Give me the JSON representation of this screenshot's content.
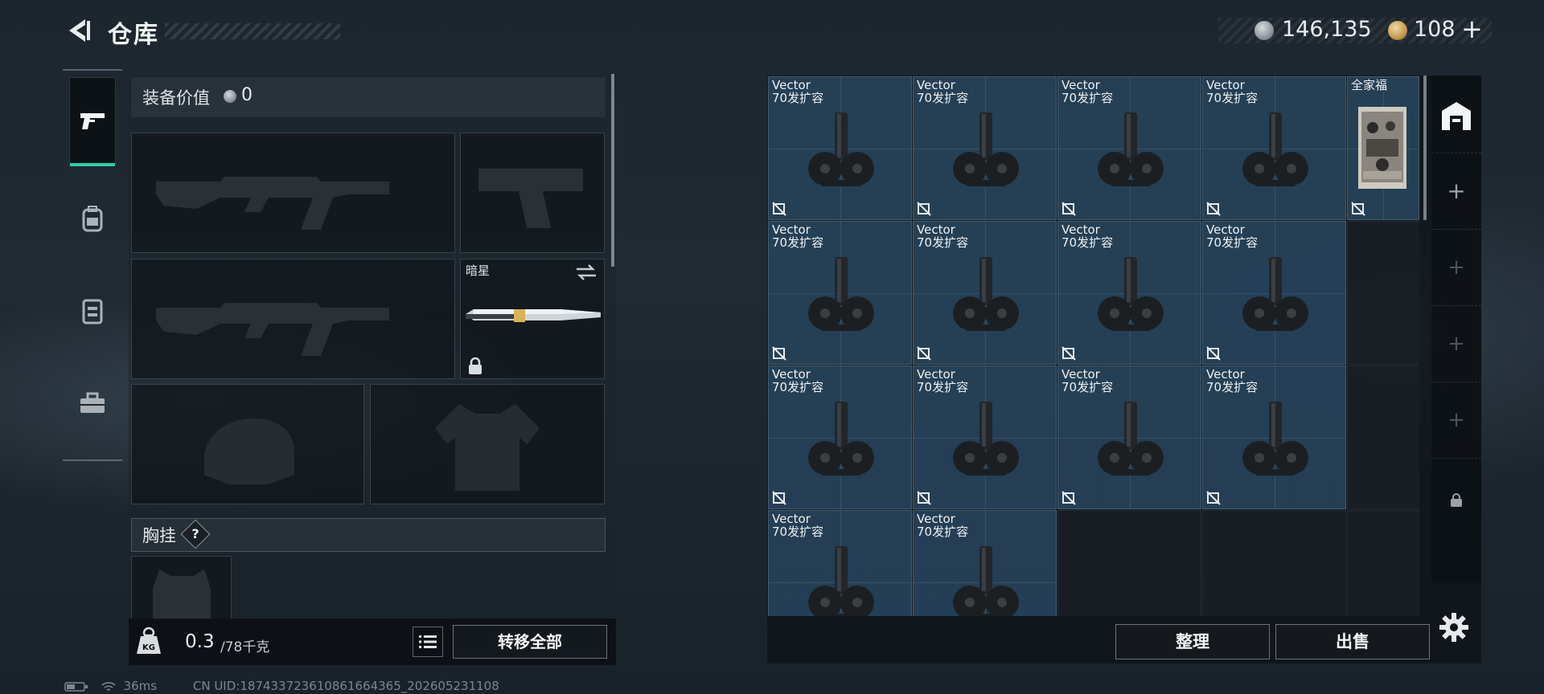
{
  "header": {
    "title": "仓库"
  },
  "currency": {
    "silver": "146,135",
    "gold": "108",
    "gold_add": "+"
  },
  "equipment": {
    "value_label": "装备价值",
    "value": "0",
    "knife_slot_label": "暗星",
    "chest_label": "胸挂",
    "chest_help": "?"
  },
  "weight": {
    "current": "0.3",
    "max": "/78千克"
  },
  "buttons": {
    "transfer_all": "转移全部",
    "sort": "整理",
    "sell": "出售"
  },
  "status": {
    "ping": "36ms",
    "uid": "CN UID:187433723610861664365_202605231108"
  },
  "storage": {
    "items": [
      {
        "name": "Vector",
        "sub": "70发扩容"
      },
      {
        "name": "Vector",
        "sub": "70发扩容"
      },
      {
        "name": "Vector",
        "sub": "70发扩容"
      },
      {
        "name": "Vector",
        "sub": "70发扩容"
      },
      {
        "name": "全家福",
        "sub": ""
      },
      {
        "name": "Vector",
        "sub": "70发扩容"
      },
      {
        "name": "Vector",
        "sub": "70发扩容"
      },
      {
        "name": "Vector",
        "sub": "70发扩容"
      },
      {
        "name": "Vector",
        "sub": "70发扩容"
      },
      {
        "name": "Vector",
        "sub": "70发扩容"
      },
      {
        "name": "Vector",
        "sub": "70发扩容"
      },
      {
        "name": "Vector",
        "sub": "70发扩容"
      },
      {
        "name": "Vector",
        "sub": "70发扩容"
      },
      {
        "name": "Vector",
        "sub": "70发扩容"
      },
      {
        "name": "Vector",
        "sub": "70发扩容"
      }
    ]
  },
  "icons": {
    "back": "back-arrow-icon",
    "rail": [
      "pistol-icon",
      "backpack-icon",
      "vest-icon",
      "toolbox-icon"
    ],
    "storage_tab": "warehouse-icon",
    "settings": "gear-icon"
  },
  "colors": {
    "accent": "#29d1a5",
    "cell_blue": "#28465f"
  }
}
